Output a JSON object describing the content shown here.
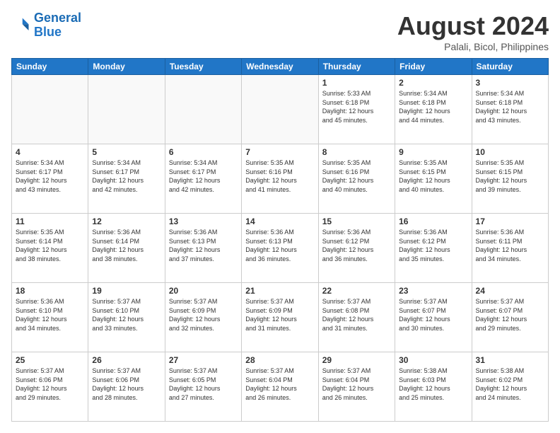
{
  "logo": {
    "line1": "General",
    "line2": "Blue"
  },
  "title": "August 2024",
  "subtitle": "Palali, Bicol, Philippines",
  "weekdays": [
    "Sunday",
    "Monday",
    "Tuesday",
    "Wednesday",
    "Thursday",
    "Friday",
    "Saturday"
  ],
  "weeks": [
    [
      {
        "day": "",
        "info": ""
      },
      {
        "day": "",
        "info": ""
      },
      {
        "day": "",
        "info": ""
      },
      {
        "day": "",
        "info": ""
      },
      {
        "day": "1",
        "info": "Sunrise: 5:33 AM\nSunset: 6:18 PM\nDaylight: 12 hours\nand 45 minutes."
      },
      {
        "day": "2",
        "info": "Sunrise: 5:34 AM\nSunset: 6:18 PM\nDaylight: 12 hours\nand 44 minutes."
      },
      {
        "day": "3",
        "info": "Sunrise: 5:34 AM\nSunset: 6:18 PM\nDaylight: 12 hours\nand 43 minutes."
      }
    ],
    [
      {
        "day": "4",
        "info": "Sunrise: 5:34 AM\nSunset: 6:17 PM\nDaylight: 12 hours\nand 43 minutes."
      },
      {
        "day": "5",
        "info": "Sunrise: 5:34 AM\nSunset: 6:17 PM\nDaylight: 12 hours\nand 42 minutes."
      },
      {
        "day": "6",
        "info": "Sunrise: 5:34 AM\nSunset: 6:17 PM\nDaylight: 12 hours\nand 42 minutes."
      },
      {
        "day": "7",
        "info": "Sunrise: 5:35 AM\nSunset: 6:16 PM\nDaylight: 12 hours\nand 41 minutes."
      },
      {
        "day": "8",
        "info": "Sunrise: 5:35 AM\nSunset: 6:16 PM\nDaylight: 12 hours\nand 40 minutes."
      },
      {
        "day": "9",
        "info": "Sunrise: 5:35 AM\nSunset: 6:15 PM\nDaylight: 12 hours\nand 40 minutes."
      },
      {
        "day": "10",
        "info": "Sunrise: 5:35 AM\nSunset: 6:15 PM\nDaylight: 12 hours\nand 39 minutes."
      }
    ],
    [
      {
        "day": "11",
        "info": "Sunrise: 5:35 AM\nSunset: 6:14 PM\nDaylight: 12 hours\nand 38 minutes."
      },
      {
        "day": "12",
        "info": "Sunrise: 5:36 AM\nSunset: 6:14 PM\nDaylight: 12 hours\nand 38 minutes."
      },
      {
        "day": "13",
        "info": "Sunrise: 5:36 AM\nSunset: 6:13 PM\nDaylight: 12 hours\nand 37 minutes."
      },
      {
        "day": "14",
        "info": "Sunrise: 5:36 AM\nSunset: 6:13 PM\nDaylight: 12 hours\nand 36 minutes."
      },
      {
        "day": "15",
        "info": "Sunrise: 5:36 AM\nSunset: 6:12 PM\nDaylight: 12 hours\nand 36 minutes."
      },
      {
        "day": "16",
        "info": "Sunrise: 5:36 AM\nSunset: 6:12 PM\nDaylight: 12 hours\nand 35 minutes."
      },
      {
        "day": "17",
        "info": "Sunrise: 5:36 AM\nSunset: 6:11 PM\nDaylight: 12 hours\nand 34 minutes."
      }
    ],
    [
      {
        "day": "18",
        "info": "Sunrise: 5:36 AM\nSunset: 6:10 PM\nDaylight: 12 hours\nand 34 minutes."
      },
      {
        "day": "19",
        "info": "Sunrise: 5:37 AM\nSunset: 6:10 PM\nDaylight: 12 hours\nand 33 minutes."
      },
      {
        "day": "20",
        "info": "Sunrise: 5:37 AM\nSunset: 6:09 PM\nDaylight: 12 hours\nand 32 minutes."
      },
      {
        "day": "21",
        "info": "Sunrise: 5:37 AM\nSunset: 6:09 PM\nDaylight: 12 hours\nand 31 minutes."
      },
      {
        "day": "22",
        "info": "Sunrise: 5:37 AM\nSunset: 6:08 PM\nDaylight: 12 hours\nand 31 minutes."
      },
      {
        "day": "23",
        "info": "Sunrise: 5:37 AM\nSunset: 6:07 PM\nDaylight: 12 hours\nand 30 minutes."
      },
      {
        "day": "24",
        "info": "Sunrise: 5:37 AM\nSunset: 6:07 PM\nDaylight: 12 hours\nand 29 minutes."
      }
    ],
    [
      {
        "day": "25",
        "info": "Sunrise: 5:37 AM\nSunset: 6:06 PM\nDaylight: 12 hours\nand 29 minutes."
      },
      {
        "day": "26",
        "info": "Sunrise: 5:37 AM\nSunset: 6:06 PM\nDaylight: 12 hours\nand 28 minutes."
      },
      {
        "day": "27",
        "info": "Sunrise: 5:37 AM\nSunset: 6:05 PM\nDaylight: 12 hours\nand 27 minutes."
      },
      {
        "day": "28",
        "info": "Sunrise: 5:37 AM\nSunset: 6:04 PM\nDaylight: 12 hours\nand 26 minutes."
      },
      {
        "day": "29",
        "info": "Sunrise: 5:37 AM\nSunset: 6:04 PM\nDaylight: 12 hours\nand 26 minutes."
      },
      {
        "day": "30",
        "info": "Sunrise: 5:38 AM\nSunset: 6:03 PM\nDaylight: 12 hours\nand 25 minutes."
      },
      {
        "day": "31",
        "info": "Sunrise: 5:38 AM\nSunset: 6:02 PM\nDaylight: 12 hours\nand 24 minutes."
      }
    ]
  ]
}
